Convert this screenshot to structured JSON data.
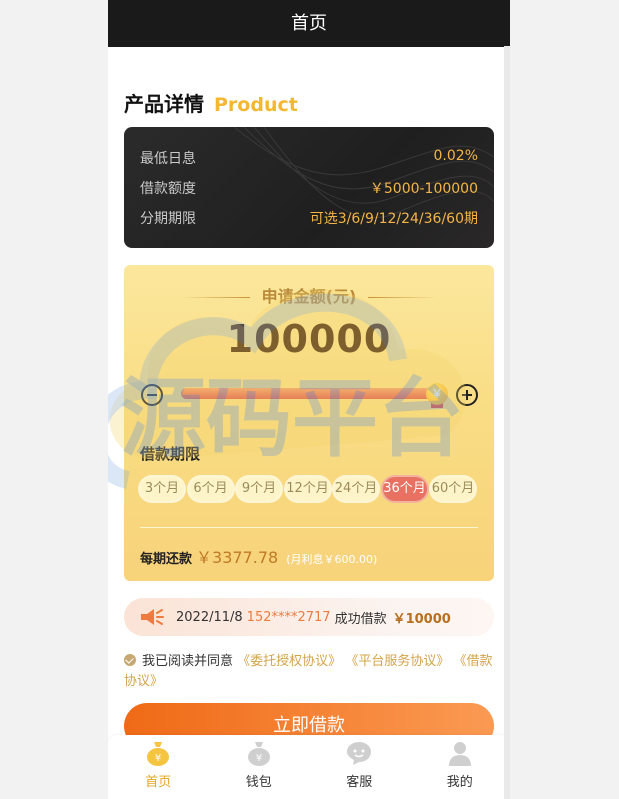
{
  "navbar": {
    "title": "首页"
  },
  "section": {
    "title_cn": "产品详情",
    "title_en": "Product"
  },
  "details": [
    {
      "label": "最低日息",
      "value": "0.02%"
    },
    {
      "label": "借款额度",
      "value": "￥5000-100000"
    },
    {
      "label": "分期期限",
      "value": "可选3/6/9/12/24/36/60期"
    }
  ],
  "apply": {
    "title": "申请金额(元)",
    "amount": "100000",
    "slider_fraction": 1.0,
    "thumb_glyph": "￥",
    "term_label": "借款期限",
    "terms": [
      "3个月",
      "6个月",
      "9个月",
      "12个月",
      "24个月",
      "36个月",
      "60个月"
    ],
    "selected_term": "36个月",
    "repay_label": "每期还款",
    "repay_amount": "￥3377.78",
    "repay_note": "(月利息￥600.00)"
  },
  "notice": {
    "date": "2022/11/8",
    "phone": "152****2717",
    "action": "成功借款",
    "amount": "￥10000"
  },
  "agreement": {
    "prefix": "我已阅读并同意",
    "links": [
      "《委托授权协议》",
      "《平台服务协议》",
      "《借款协议》"
    ]
  },
  "cta": {
    "label": "立即借款"
  },
  "tabbar": [
    {
      "label": "首页",
      "icon": "money-bag-icon",
      "active": true
    },
    {
      "label": "钱包",
      "icon": "wallet-bag-icon",
      "active": false
    },
    {
      "label": "客服",
      "icon": "chat-icon",
      "active": false
    },
    {
      "label": "我的",
      "icon": "user-icon",
      "active": false
    }
  ],
  "watermark": {
    "text": "源码平台"
  },
  "colors": {
    "accent": "#f5b731",
    "cta": "#ef6a16",
    "active_term": "#e87162",
    "gold_card": "#f9dd84"
  }
}
